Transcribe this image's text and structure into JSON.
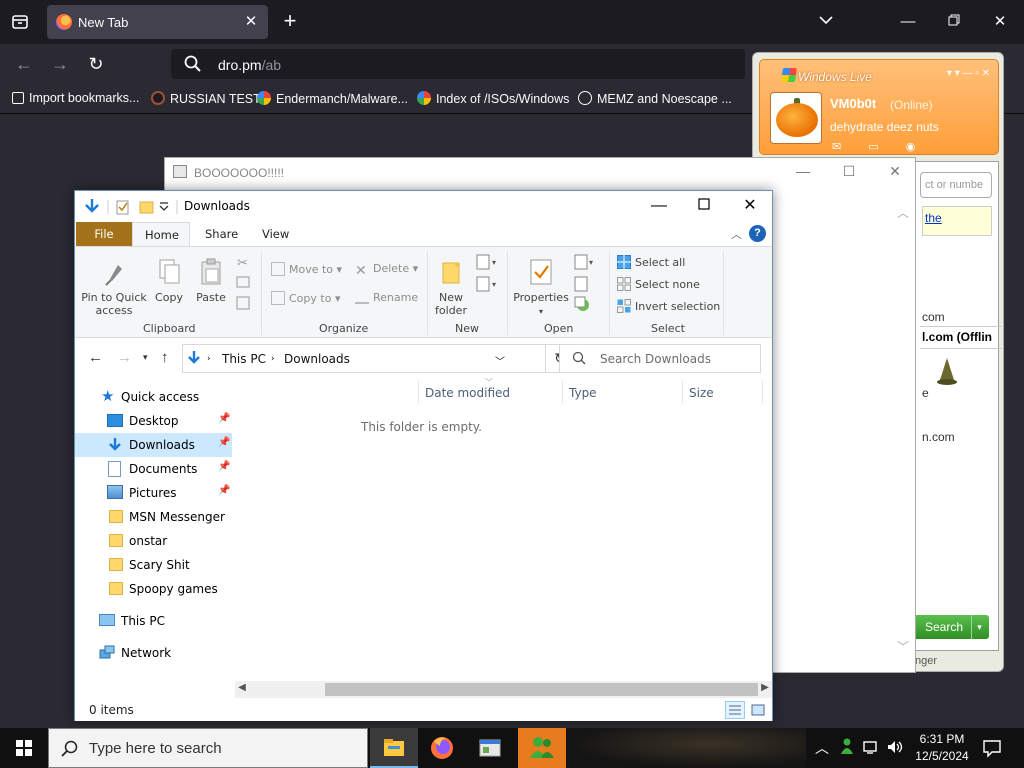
{
  "browser": {
    "tab_title": "New Tab",
    "url_host": "dro.pm",
    "url_path": "/ab",
    "bookmarks": [
      {
        "label": "Import bookmarks..."
      },
      {
        "label": "RUSSIAN TEST"
      },
      {
        "label": "Endermanch/Malware..."
      },
      {
        "label": "Index of /ISOs/Windows"
      },
      {
        "label": "MEMZ and Noescape ..."
      }
    ]
  },
  "boo_window": {
    "title": "BOOOOOOO!!!!!"
  },
  "msn": {
    "logo": "Windows Live",
    "display_name": "VM0b0t",
    "status": "(Online)",
    "personal_message": "dehydrate deez nuts",
    "search_placeholder": "ct or numbe",
    "link_text": "the",
    "contacts": [
      {
        "text": "com"
      },
      {
        "text": "l.com  (Offlin"
      },
      {
        "text": "e"
      },
      {
        "text": "n.com"
      }
    ],
    "search_button": "Search",
    "footer": "nger"
  },
  "explorer": {
    "title": "Downloads",
    "tabs": {
      "file": "File",
      "home": "Home",
      "share": "Share",
      "view": "View"
    },
    "ribbon": {
      "clipboard": {
        "pin": "Pin to Quick access",
        "copy": "Copy",
        "paste": "Paste",
        "label": "Clipboard"
      },
      "organize": {
        "move_to": "Move to",
        "copy_to": "Copy to",
        "delete": "Delete",
        "rename": "Rename",
        "label": "Organize"
      },
      "new": {
        "new_folder": "New folder",
        "label": "New"
      },
      "open": {
        "properties": "Properties",
        "label": "Open"
      },
      "select": {
        "select_all": "Select all",
        "select_none": "Select none",
        "invert": "Invert selection",
        "label": "Select"
      }
    },
    "address": [
      "This PC",
      "Downloads"
    ],
    "search_placeholder": "Search Downloads",
    "nav": [
      {
        "label": "Quick access"
      },
      {
        "label": "Desktop"
      },
      {
        "label": "Downloads"
      },
      {
        "label": "Documents"
      },
      {
        "label": "Pictures"
      },
      {
        "label": "MSN Messenger"
      },
      {
        "label": "onstar"
      },
      {
        "label": "Scary Shit"
      },
      {
        "label": "Spoopy games"
      },
      {
        "label": "This PC"
      },
      {
        "label": "Network"
      }
    ],
    "columns": {
      "date": "Date modified",
      "type": "Type",
      "size": "Size"
    },
    "empty_message": "This folder is empty.",
    "status": "0 items"
  },
  "taskbar": {
    "search_text": "Type here to search",
    "time": "6:31 PM",
    "date": "12/5/2024"
  },
  "colors": {
    "file_tab": "#a5721c",
    "selected_nav": "#cce8ff",
    "msn_orange": "#ff9f3a",
    "msn_search_green": "#2e8f24"
  }
}
